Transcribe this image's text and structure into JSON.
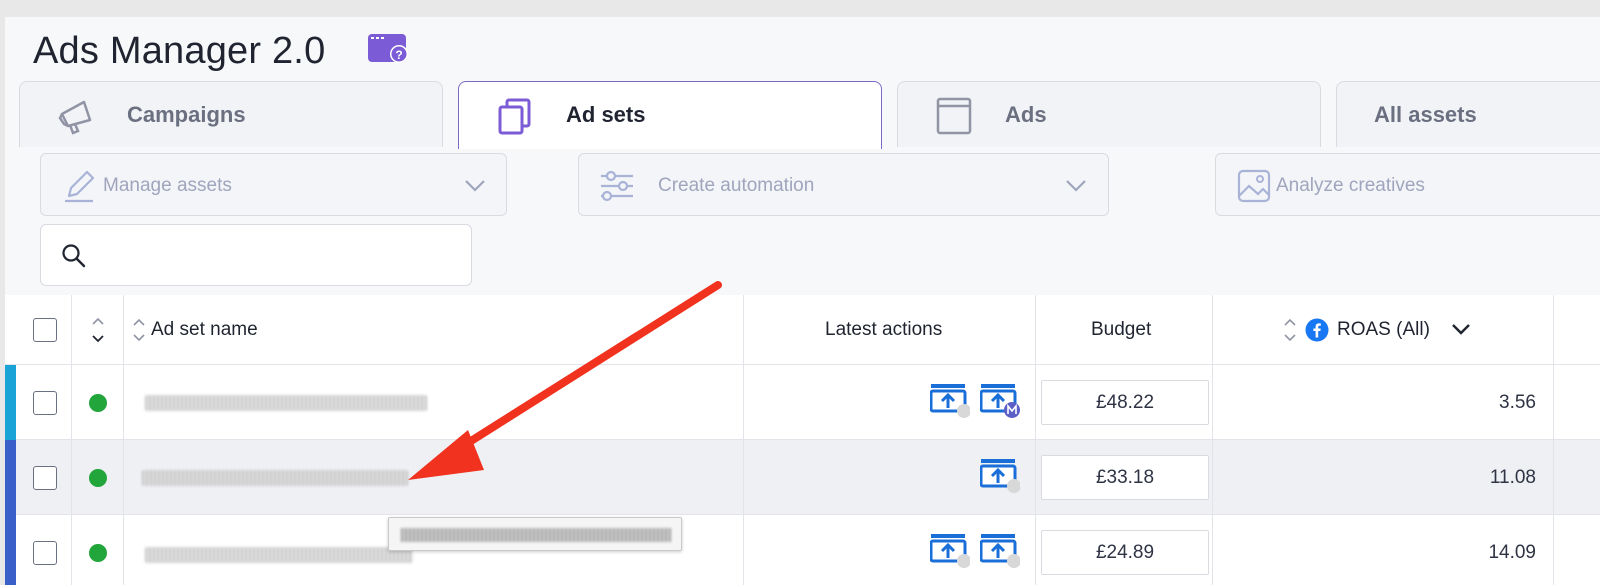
{
  "app": {
    "title": "Ads Manager 2.0",
    "title_icon": "help-window-icon",
    "accent_color": "#7b5cd6"
  },
  "tabs": [
    {
      "label": "Campaigns",
      "icon": "megaphone-icon",
      "active": false
    },
    {
      "label": "Ad sets",
      "icon": "layers-icon",
      "active": true
    },
    {
      "label": "Ads",
      "icon": "square-icon",
      "active": false
    },
    {
      "label": "All assets",
      "icon": "",
      "active": false
    }
  ],
  "toolbar": {
    "manage_assets": "Manage assets",
    "create_automation": "Create automation",
    "analyze_creatives": "Analyze creatives"
  },
  "search": {
    "placeholder": "",
    "value": ""
  },
  "table": {
    "columns": {
      "name": "Ad set name",
      "latest_actions": "Latest actions",
      "budget": "Budget",
      "roas": "ROAS (All)"
    },
    "rows": [
      {
        "status_color": "#22a53a",
        "stripe_color": "#1aa3d6",
        "budget": "£48.22",
        "roas": "3.56",
        "actions": [
          "budget-upload-icon",
          "budget-upload-meta-icon"
        ]
      },
      {
        "status_color": "#22a53a",
        "stripe_color": "#3b5fc9",
        "budget": "£33.18",
        "roas": "11.08",
        "actions": [
          "budget-upload-icon"
        ]
      },
      {
        "status_color": "#22a53a",
        "stripe_color": "#3b5fc9",
        "budget": "£24.89",
        "roas": "14.09",
        "actions": [
          "budget-upload-icon",
          "budget-upload-icon"
        ]
      }
    ]
  },
  "annotation": {
    "arrow_color": "#f0321e"
  }
}
